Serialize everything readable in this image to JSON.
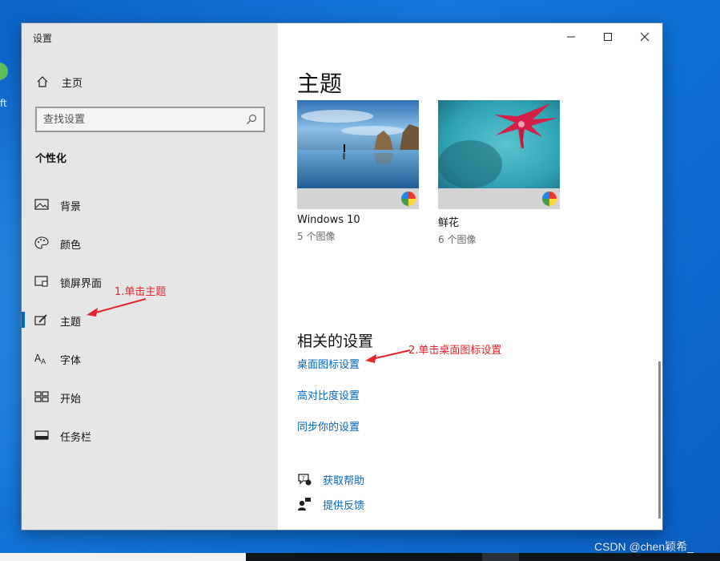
{
  "desktop": {
    "partial_text": "ft",
    "watermark": "CSDN @chen颖希_"
  },
  "window": {
    "title": "设置",
    "controls": {
      "minimize": "minimize-icon",
      "maximize": "maximize-icon",
      "close": "close-icon"
    }
  },
  "sidebar": {
    "home_label": "主页",
    "search_placeholder": "查找设置",
    "section_title": "个性化",
    "items": [
      {
        "label": "背景",
        "icon": "picture-icon"
      },
      {
        "label": "颜色",
        "icon": "palette-icon"
      },
      {
        "label": "锁屏界面",
        "icon": "lock-screen-icon"
      },
      {
        "label": "主题",
        "icon": "theme-brush-icon",
        "active": true
      },
      {
        "label": "字体",
        "icon": "font-icon"
      },
      {
        "label": "开始",
        "icon": "start-grid-icon"
      },
      {
        "label": "任务栏",
        "icon": "taskbar-icon"
      }
    ]
  },
  "main": {
    "title": "主题",
    "themes": [
      {
        "name": "Windows 10",
        "count": "5 个图像"
      },
      {
        "name": "鲜花",
        "count": "6 个图像"
      }
    ],
    "related_title": "相关的设置",
    "related_links": [
      "桌面图标设置",
      "高对比度设置",
      "同步你的设置"
    ],
    "help": [
      {
        "label": "获取帮助",
        "icon": "help-chat-icon"
      },
      {
        "label": "提供反馈",
        "icon": "feedback-icon"
      }
    ]
  },
  "annotations": {
    "step1": "1.单击主题",
    "step2": "2.单击桌面图标设置"
  },
  "colors": {
    "accent": "#0067c0",
    "annotation": "#e8232a",
    "sidebar_bg": "#e6e6e6"
  }
}
